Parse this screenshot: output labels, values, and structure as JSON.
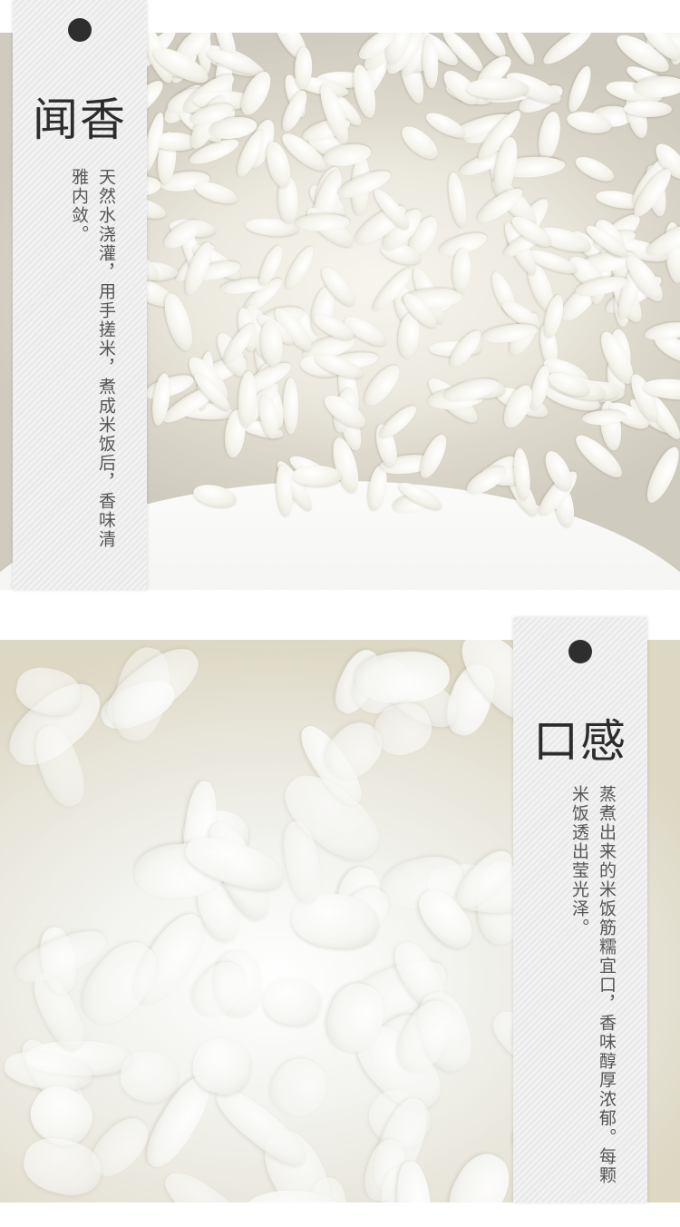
{
  "sections": [
    {
      "title": "闻香",
      "text": "天然水浇灌，用手搓米，煮成米饭后，香味清雅内敛。"
    },
    {
      "title": "口感",
      "text": "蒸煮出来的米饭筋糯宜口，香味醇厚浓郁。每颗米饭透出莹光泽。"
    }
  ],
  "colors": {
    "tag": "#eeeeee",
    "hole": "#2e2e2e",
    "title": "#2c2c2c",
    "text": "#555555"
  }
}
